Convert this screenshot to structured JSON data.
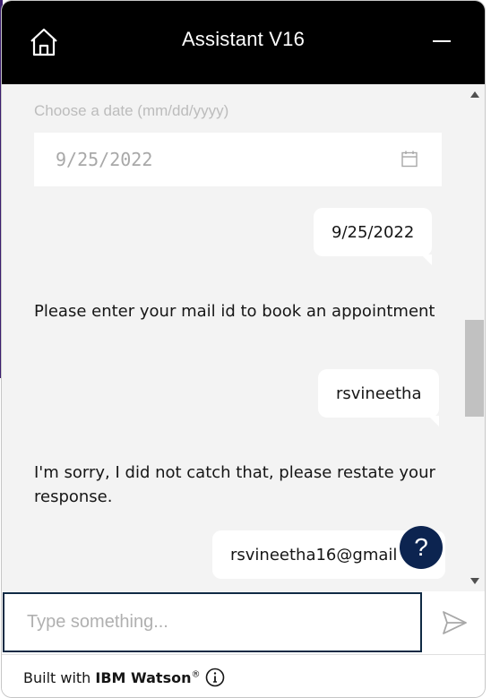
{
  "header": {
    "title": "Assistant V16",
    "home_icon": "home-icon",
    "minimize_icon": "minimize-icon"
  },
  "conversation": {
    "date_picker": {
      "label": "Choose a date (mm/dd/yyyy)",
      "value": "9/25/2022",
      "icon": "calendar-icon"
    },
    "messages": [
      {
        "from": "user",
        "text": "9/25/2022"
      },
      {
        "from": "bot",
        "text": "Please enter your mail id to book an appointment"
      },
      {
        "from": "user",
        "text": "rsvineetha"
      },
      {
        "from": "bot",
        "text": "I'm sorry, I did not catch that, please restate your response."
      },
      {
        "from": "user",
        "text": "rsvineetha16@gmail"
      }
    ]
  },
  "help_button": {
    "label": "?"
  },
  "composer": {
    "placeholder": "Type something...",
    "send_icon": "send-icon"
  },
  "footer": {
    "prefix": "Built with ",
    "brand": "IBM Watson",
    "registered": "®",
    "info_icon": "info-icon"
  },
  "colors": {
    "header_bg": "#000000",
    "panel_bg": "#f3f3f3",
    "help_bg": "#0c2450",
    "input_border": "#0f2a44"
  }
}
